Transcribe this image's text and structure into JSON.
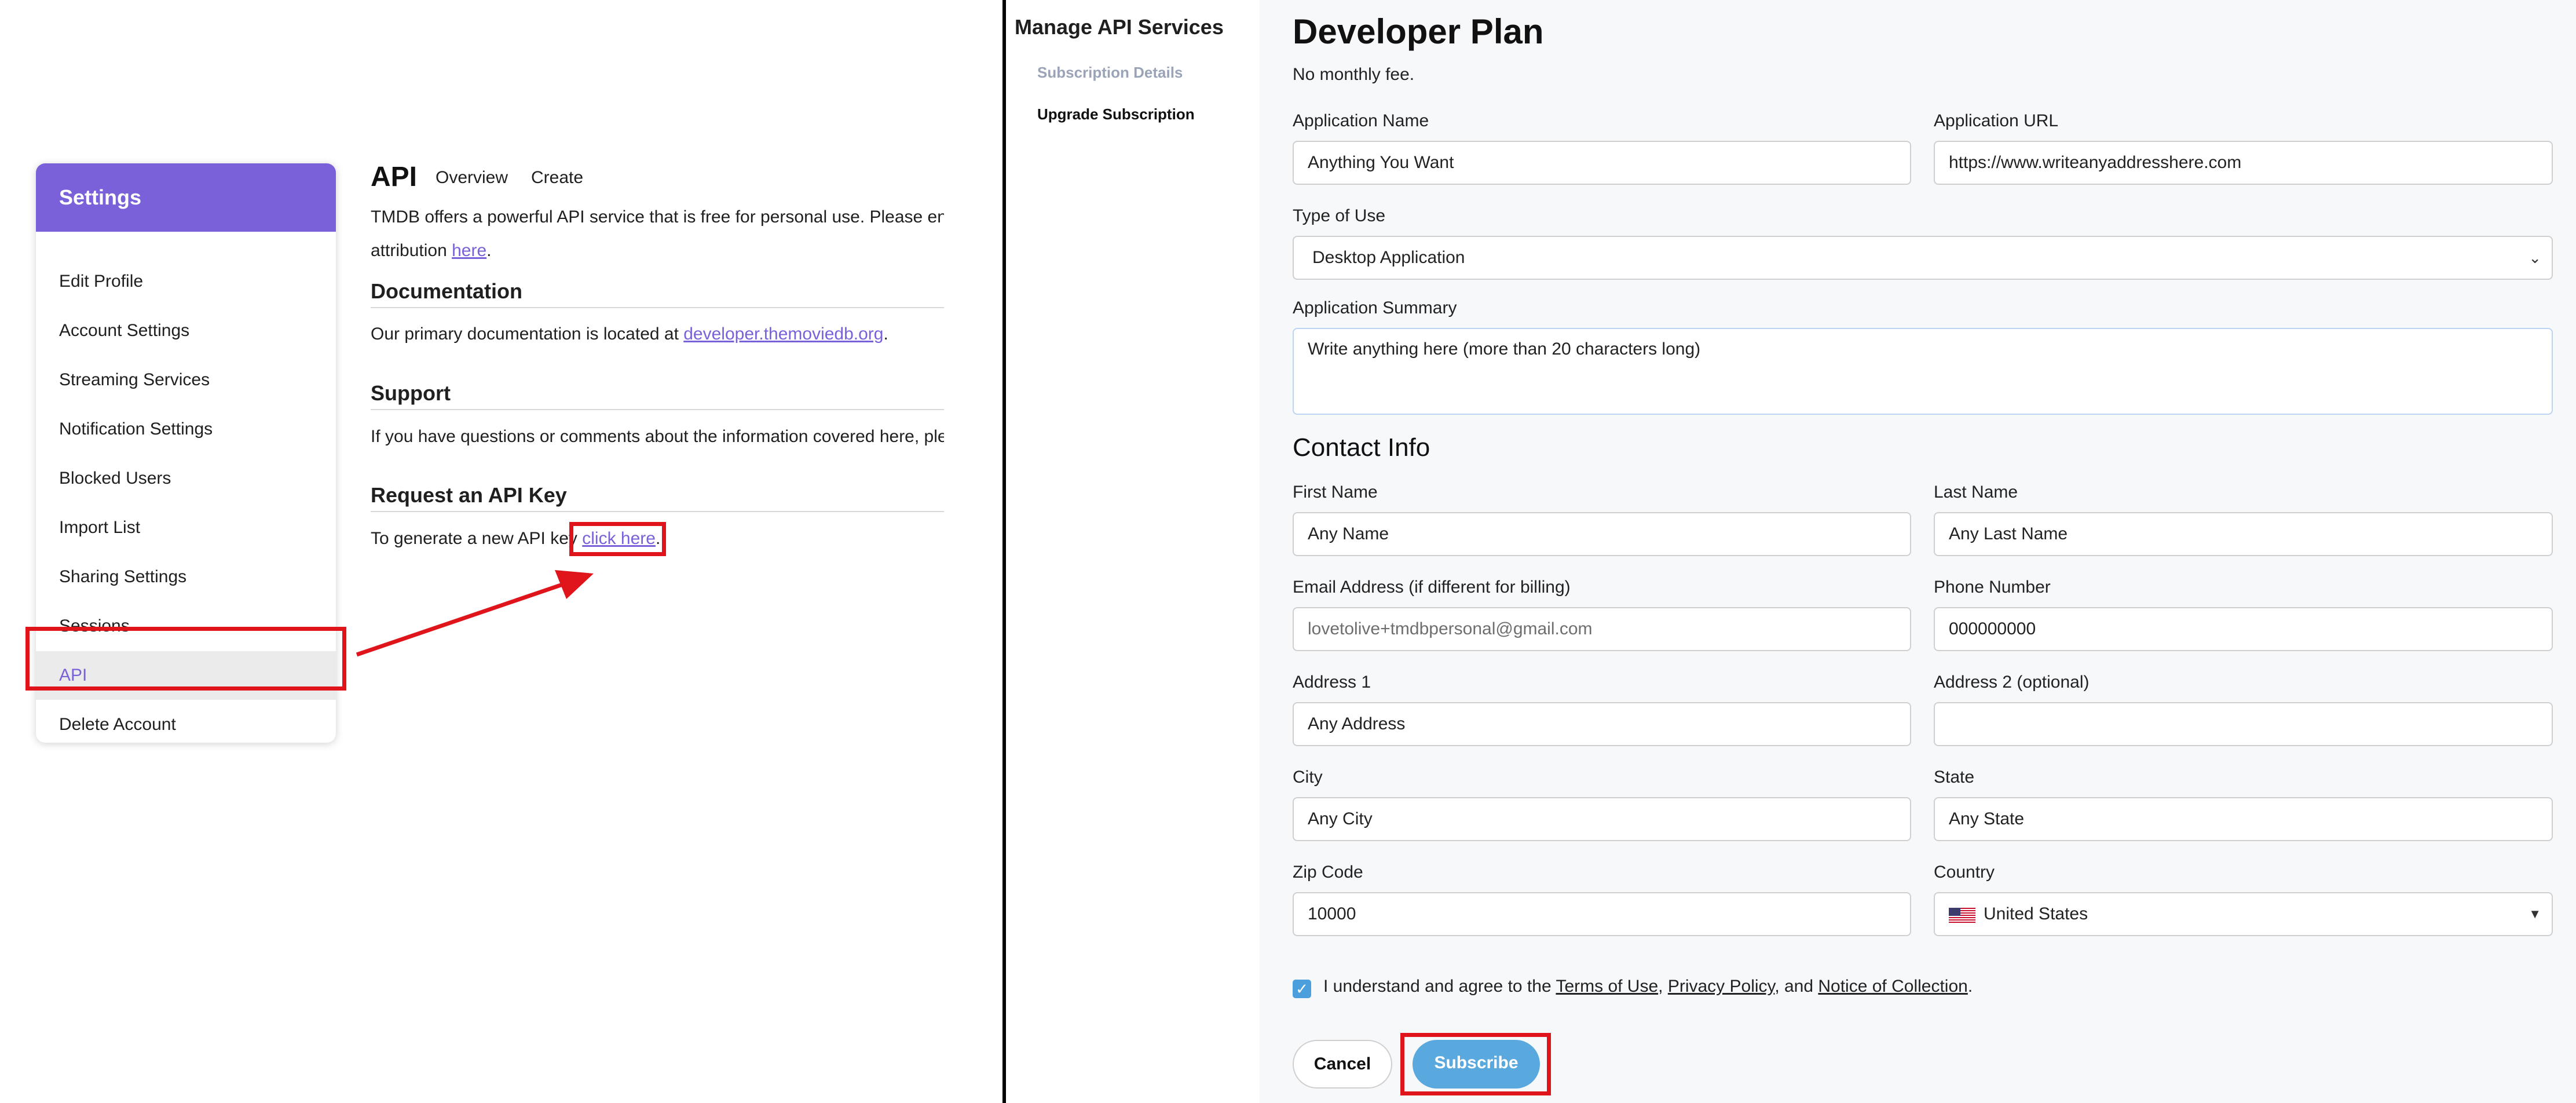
{
  "settings": {
    "title": "Settings",
    "items": [
      {
        "label": "Edit Profile"
      },
      {
        "label": "Account Settings"
      },
      {
        "label": "Streaming Services"
      },
      {
        "label": "Notification Settings"
      },
      {
        "label": "Blocked Users"
      },
      {
        "label": "Import List"
      },
      {
        "label": "Sharing Settings"
      },
      {
        "label": "Sessions"
      },
      {
        "label": "API"
      },
      {
        "label": "Delete Account"
      }
    ]
  },
  "api": {
    "title": "API",
    "tabs": [
      "Overview",
      "Create"
    ],
    "intro_line1": "TMDB offers a powerful API service that is free for personal use. Please ensu",
    "intro_line2_prefix": "attribution ",
    "intro_link": "here",
    "intro_suffix": ".",
    "documentation": {
      "title": "Documentation",
      "text_prefix": "Our primary documentation is located at ",
      "link": "developer.themoviedb.org",
      "text_suffix": "."
    },
    "support": {
      "title": "Support",
      "text": "If you have questions or comments about the information covered here, ple"
    },
    "request": {
      "title": "Request an API Key",
      "text_prefix": "To generate a new API key",
      "link": "click here",
      "text_suffix": "."
    }
  },
  "manage": {
    "title": "Manage API Services",
    "nav": [
      "Subscription Details",
      "Upgrade Subscription"
    ]
  },
  "plan": {
    "title": "Developer Plan",
    "subtitle": "No monthly fee.",
    "fields": {
      "app_name": {
        "label": "Application Name",
        "value": "Anything You Want"
      },
      "app_url": {
        "label": "Application URL",
        "value": "https://www.writeanyaddresshere.com"
      },
      "type_of_use": {
        "label": "Type of Use",
        "value": "Desktop Application"
      },
      "summary": {
        "label": "Application Summary",
        "value": "Write anything here (more than 20 characters long)"
      }
    }
  },
  "contact": {
    "title": "Contact Info",
    "first_name": {
      "label": "First Name",
      "value": "Any Name"
    },
    "last_name": {
      "label": "Last Name",
      "value": "Any Last Name"
    },
    "email": {
      "label": "Email Address (if different for billing)",
      "value": "lovetolive+tmdbpersonal@gmail.com"
    },
    "phone": {
      "label": "Phone Number",
      "value": "000000000"
    },
    "address1": {
      "label": "Address 1",
      "value": "Any Address"
    },
    "address2": {
      "label": "Address 2 (optional)",
      "value": ""
    },
    "city": {
      "label": "City",
      "value": "Any City"
    },
    "state": {
      "label": "State",
      "value": "Any State"
    },
    "zip": {
      "label": "Zip Code",
      "value": "10000"
    },
    "country": {
      "label": "Country",
      "value": "United States"
    }
  },
  "agreement": {
    "checked": true,
    "prefix": "I understand and agree to the ",
    "terms": "Terms of Use",
    "sep1": ", ",
    "privacy": "Privacy Policy",
    "sep2": ", and ",
    "notice": "Notice of Collection",
    "suffix": "."
  },
  "actions": {
    "cancel": "Cancel",
    "subscribe": "Subscribe"
  },
  "colors": {
    "accent_purple": "#7b61d9",
    "subscribe_blue": "#5aa9de",
    "highlight_red": "#e0141b",
    "checkbox_blue": "#4a9fdc"
  },
  "icons": {
    "country_flag": "us-flag-icon",
    "select_arrow": "chevron-down-icon",
    "pointer_arrow": "red-arrow-annotation"
  }
}
